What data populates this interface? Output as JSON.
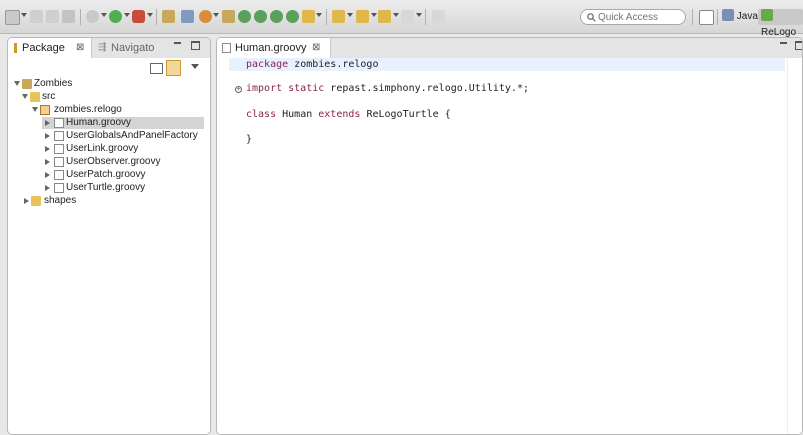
{
  "toolbar": {
    "quick_access_placeholder": "Quick Access",
    "perspectives": [
      {
        "label": "Java",
        "icon": "java-perspective-icon"
      },
      {
        "label": "ReLogo",
        "icon": "relogo-perspective-icon"
      }
    ]
  },
  "left_pane": {
    "tabs": [
      {
        "label": "Package",
        "icon": "package-explorer-icon",
        "active": true
      },
      {
        "label": "Navigato",
        "icon": "navigator-icon",
        "active": false
      }
    ],
    "tree": [
      {
        "label": "Zombies",
        "icon": "project-icon",
        "level": 0,
        "expanded": true
      },
      {
        "label": "src",
        "icon": "source-folder-icon",
        "level": 1,
        "expanded": true
      },
      {
        "label": "zombies.relogo",
        "icon": "package-icon",
        "level": 2,
        "expanded": true
      },
      {
        "label": "Human.groovy",
        "icon": "groovy-file-icon",
        "level": 3,
        "expanded": false,
        "selected": true
      },
      {
        "label": "UserGlobalsAndPanelFactory",
        "icon": "groovy-file-icon",
        "level": 3,
        "expanded": false
      },
      {
        "label": "UserLink.groovy",
        "icon": "groovy-file-icon",
        "level": 3,
        "expanded": false
      },
      {
        "label": "UserObserver.groovy",
        "icon": "groovy-file-icon",
        "level": 3,
        "expanded": false
      },
      {
        "label": "UserPatch.groovy",
        "icon": "groovy-file-icon",
        "level": 3,
        "expanded": false
      },
      {
        "label": "UserTurtle.groovy",
        "icon": "groovy-file-icon",
        "level": 3,
        "expanded": false
      },
      {
        "label": "shapes",
        "icon": "folder-icon",
        "level": 1,
        "expanded": false
      }
    ]
  },
  "editor": {
    "tab_label": "Human.groovy",
    "lines": {
      "package_kw": "package",
      "package_name": " zombies.relogo",
      "import_kw": "import static",
      "import_rest": " repast.simphony.relogo.Utility.*;",
      "class_kw": "class",
      "class_name": " Human ",
      "extends_kw": "extends",
      "extends_rest": " ReLogoTurtle {",
      "closing_brace": "}"
    }
  },
  "colors": {
    "keyword": "#8b2252",
    "selection": "#d4d4d4",
    "current_line": "#e8f2fe"
  }
}
